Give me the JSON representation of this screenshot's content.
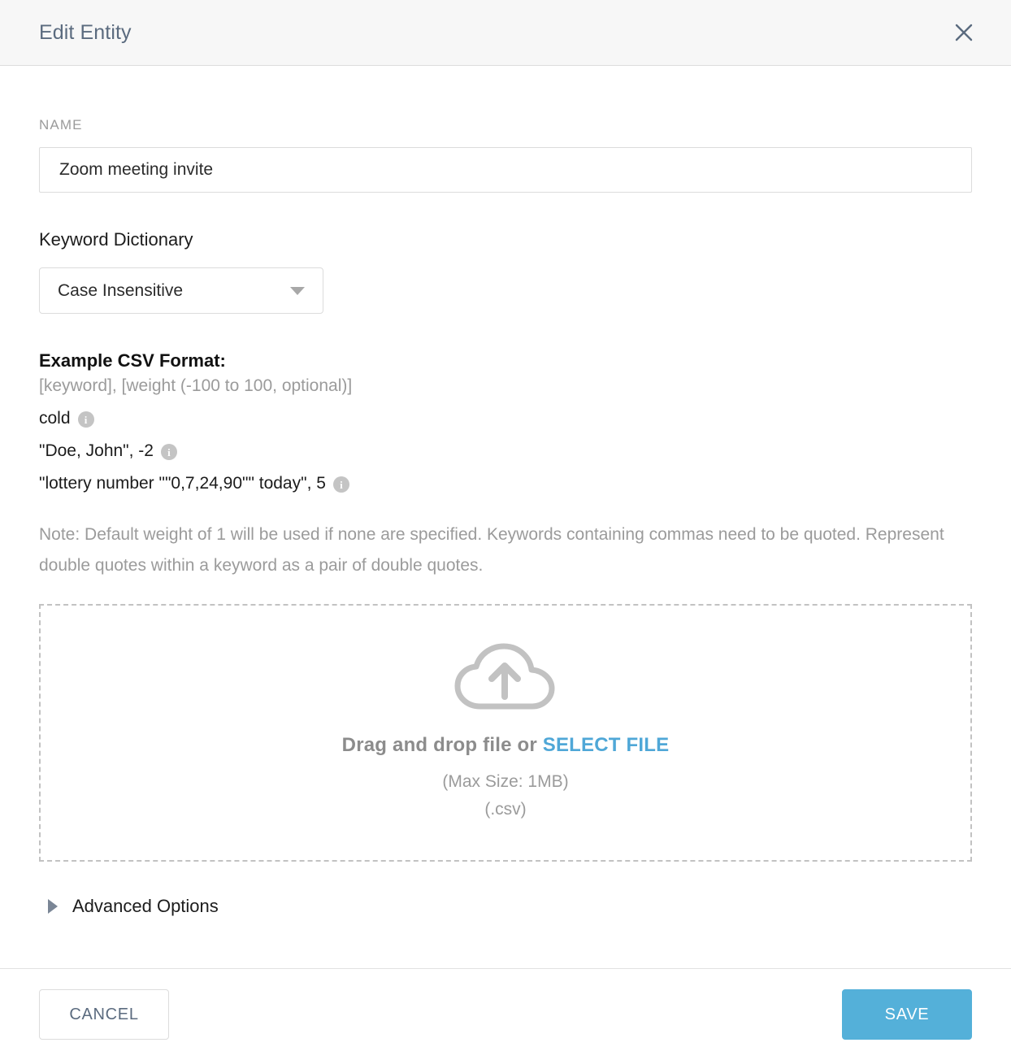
{
  "header": {
    "title": "Edit Entity",
    "close_icon": "close-icon"
  },
  "form": {
    "name_label": "NAME",
    "name_value": "Zoom meeting invite",
    "name_placeholder": "",
    "dictionary_label": "Keyword Dictionary",
    "dictionary_selected": "Case Insensitive",
    "dictionary_caret_icon": "chevron-down-icon"
  },
  "csv_example": {
    "heading": "Example CSV Format:",
    "format_line": "[keyword], [weight (-100 to 100, optional)]",
    "rows": [
      {
        "text": "cold",
        "info_icon": "info-icon"
      },
      {
        "text": "\"Doe, John\", -2",
        "info_icon": "info-icon"
      },
      {
        "text": "\"lottery number \"\"0,7,24,90\"\" today\", 5",
        "info_icon": "info-icon"
      }
    ],
    "info_glyph": "i",
    "note": "Note: Default weight of 1 will be used if none are specified. Keywords containing commas need to be quoted. Represent double quotes within a keyword as a pair of double quotes."
  },
  "dropzone": {
    "icon": "cloud-upload-icon",
    "main_prefix": "Drag and drop file or ",
    "select_file_link": "SELECT FILE",
    "max_size": "(Max Size: 1MB)",
    "file_types": "(.csv)"
  },
  "advanced": {
    "label": "Advanced Options",
    "caret_icon": "caret-right-icon"
  },
  "footer": {
    "cancel_label": "CANCEL",
    "save_label": "SAVE"
  },
  "colors": {
    "accent_blue": "#54b0d9",
    "link_blue": "#4fa7d7",
    "title_slate": "#5b6b7f",
    "muted_gray": "#9b9b9b",
    "header_bg": "#f7f7f7"
  }
}
